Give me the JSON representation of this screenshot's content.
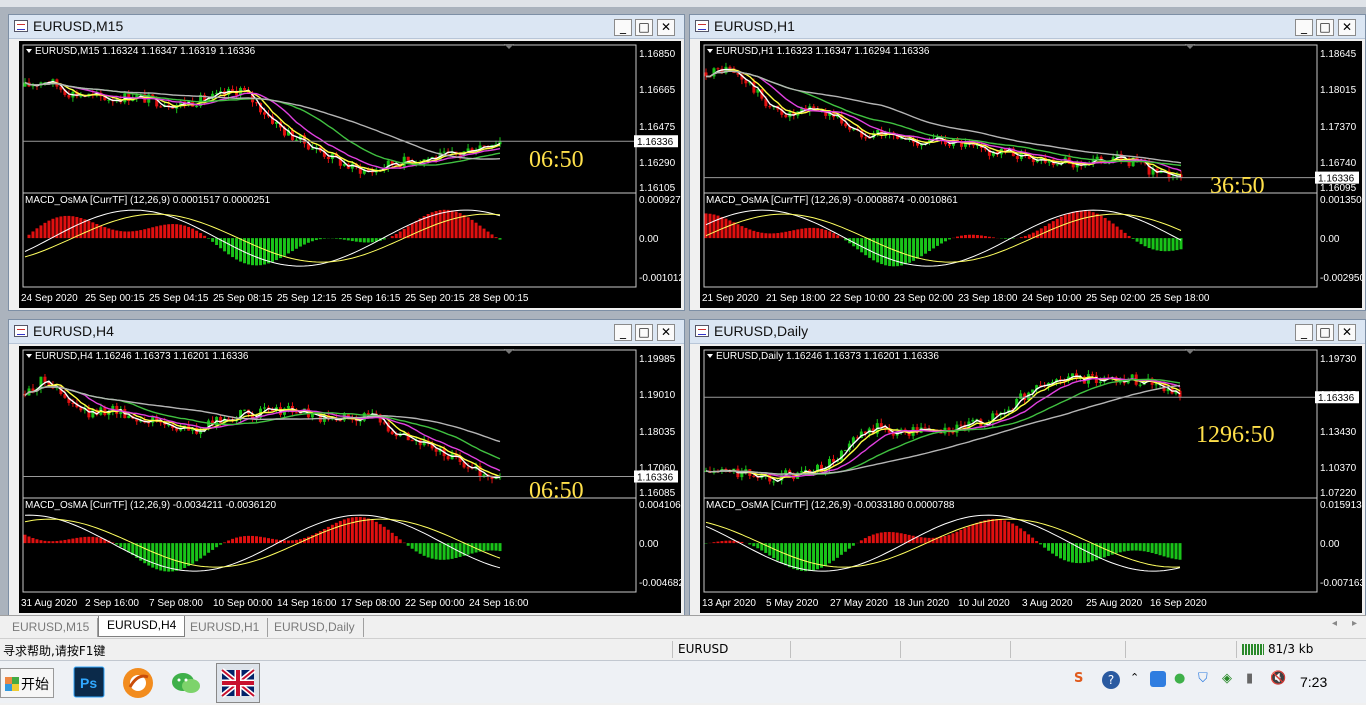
{
  "windows": [
    {
      "title": "EURUSD,M15",
      "header": "EURUSD,M15  1.16324 1.16347 1.16319 1.16336",
      "price_labels": [
        "1.16850",
        "1.16665",
        "1.16475",
        "1.16290",
        "1.16105"
      ],
      "current_price": "1.16336",
      "timer": "06:50",
      "macd_header": "MACD_OsMA [CurrTF] (12,26,9) 0.0001517 0.0000251",
      "macd_labels": [
        "0.000927",
        "0.00",
        "-0.001012"
      ],
      "time_labels": [
        "24 Sep 2020",
        "25 Sep 00:15",
        "25 Sep 04:15",
        "25 Sep 08:15",
        "25 Sep 12:15",
        "25 Sep 16:15",
        "25 Sep 20:15",
        "28 Sep 00:15"
      ],
      "trend": [
        0.8,
        0.86,
        0.75,
        0.72,
        0.7,
        0.72,
        0.68,
        0.65,
        0.68,
        0.72,
        0.78,
        0.6,
        0.42,
        0.32,
        0.22,
        0.12,
        0.08,
        0.15,
        0.18,
        0.2,
        0.22,
        0.3,
        0.34
      ]
    },
    {
      "title": "EURUSD,H1",
      "header": "EURUSD,H1  1.16323 1.16347 1.16294 1.16336",
      "price_labels": [
        "1.18645",
        "1.18015",
        "1.17370",
        "1.16740",
        "1.16095"
      ],
      "current_price": "1.16336",
      "timer": "36:50",
      "macd_header": "MACD_OsMA [CurrTF] (12,26,9) -0.0008874 -0.0010861",
      "macd_labels": [
        "0.0013508",
        "0.00",
        "-0.002950"
      ],
      "time_labels": [
        "21 Sep 2020",
        "21 Sep 18:00",
        "22 Sep 10:00",
        "23 Sep 02:00",
        "23 Sep 18:00",
        "24 Sep 10:00",
        "25 Sep 02:00",
        "25 Sep 18:00"
      ],
      "trend": [
        0.92,
        0.95,
        0.82,
        0.62,
        0.55,
        0.62,
        0.55,
        0.4,
        0.42,
        0.36,
        0.33,
        0.35,
        0.3,
        0.25,
        0.24,
        0.2,
        0.18,
        0.14,
        0.17,
        0.2,
        0.15,
        0.05,
        0.06
      ]
    },
    {
      "title": "EURUSD,H4",
      "header": "EURUSD,H4  1.16246 1.16373 1.16201 1.16336",
      "price_labels": [
        "1.19985",
        "1.19010",
        "1.18035",
        "1.17060",
        "1.16085"
      ],
      "current_price": "1.16336",
      "timer": "06:50",
      "macd_header": "MACD_OsMA [CurrTF] (12,26,9) -0.0034211 -0.0036120",
      "macd_labels": [
        "0.0041068",
        "0.00",
        "-0.004682"
      ],
      "time_labels": [
        "31 Aug 2020",
        "2 Sep 16:00",
        "7 Sep 08:00",
        "10 Sep 00:00",
        "14 Sep 16:00",
        "17 Sep 08:00",
        "22 Sep 00:00",
        "24 Sep 16:00"
      ],
      "trend": [
        0.78,
        0.92,
        0.7,
        0.6,
        0.66,
        0.58,
        0.55,
        0.5,
        0.46,
        0.56,
        0.6,
        0.62,
        0.65,
        0.62,
        0.55,
        0.58,
        0.6,
        0.48,
        0.4,
        0.3,
        0.22,
        0.12,
        0.05
      ]
    },
    {
      "title": "EURUSD,Daily",
      "header": "EURUSD,Daily  1.16246 1.16373 1.16201 1.16336",
      "price_labels": [
        "1.19730",
        "1.16585",
        "1.13430",
        "1.10370",
        "1.07220"
      ],
      "current_price": "1.16336",
      "timer": "1296:50",
      "macd_header": "MACD_OsMA [CurrTF] (12,26,9) -0.0033180 0.0000788",
      "macd_labels": [
        "0.0159138",
        "0.00",
        "-0.007163"
      ],
      "time_labels": [
        "13 Apr 2020",
        "5 May 2020",
        "27 May 2020",
        "18 Jun 2020",
        "10 Jul 2020",
        "3 Aug 2020",
        "25 Aug 2020",
        "16 Sep 2020"
      ],
      "trend": [
        0.12,
        0.12,
        0.1,
        0.08,
        0.1,
        0.12,
        0.22,
        0.4,
        0.5,
        0.45,
        0.48,
        0.46,
        0.5,
        0.55,
        0.65,
        0.8,
        0.88,
        0.92,
        0.9,
        0.92,
        0.9,
        0.88,
        0.75
      ]
    }
  ],
  "tabs": [
    "EURUSD,M15",
    "EURUSD,H4",
    "EURUSD,H1",
    "EURUSD,Daily"
  ],
  "active_tab": "EURUSD,H4",
  "status": {
    "help": "寻求帮助,请按F1键",
    "symbol": "EURUSD",
    "traffic": "81/3 kb"
  },
  "taskbar": {
    "start": "开始",
    "apps": [
      "photoshop-icon",
      "browser-icon",
      "wechat-icon",
      "uk-flag-icon"
    ],
    "clock": "7:23"
  },
  "colors": {
    "bull": "#19c319",
    "bear": "#e01010",
    "ma_fast": "#ffffff",
    "ma_mid": "#ffff40",
    "ma_slow": "#e040e0",
    "ma_green": "#40c040",
    "ma_gray": "#b4b4b4",
    "timer": "#ffe04a"
  }
}
